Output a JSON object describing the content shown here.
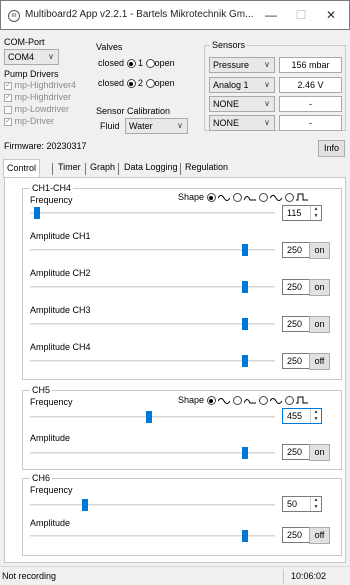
{
  "window": {
    "title": "Multiboard2 App v2.2.1 - Bartels Mikrotechnik Gm...",
    "icon_text": "m",
    "minimize": "—",
    "maximize": "☐",
    "close": "✕"
  },
  "com_port": {
    "label": "COM-Port",
    "value": "COM4"
  },
  "pump_drivers": {
    "label": "Pump Drivers",
    "items": [
      {
        "label": "mp-Highdriver4",
        "checked": true
      },
      {
        "label": "mp-Highdriver",
        "checked": true
      },
      {
        "label": "mp-Lowdriver",
        "checked": false
      },
      {
        "label": "mp-Driver",
        "checked": true
      }
    ]
  },
  "valves": {
    "label": "Valves",
    "rows": [
      {
        "state": "closed",
        "number": "1",
        "open": "open"
      },
      {
        "state": "closed",
        "number": "2",
        "open": "open"
      }
    ]
  },
  "sensor_calibration": {
    "label": "Sensor Calibration",
    "fluid_label": "Fluid",
    "fluid_value": "Water"
  },
  "sensors": {
    "label": "Sensors",
    "rows": [
      {
        "type": "Pressure",
        "value": "156 mbar"
      },
      {
        "type": "Analog 1",
        "value": "2.46 V"
      },
      {
        "type": "NONE",
        "value": "-"
      },
      {
        "type": "NONE",
        "value": "-"
      }
    ]
  },
  "firmware": "Firmware: 20230317",
  "info_button": "Info",
  "tabs": [
    "Control",
    "Timer",
    "Graph",
    "Data Logging",
    "Regulation"
  ],
  "control": {
    "ch1_4": {
      "title": "CH1-CH4",
      "frequency_label": "Frequency",
      "shape_label": "Shape",
      "frequency": "115",
      "amplitudes": [
        {
          "label": "Amplitude CH1",
          "value": "250",
          "toggle": "on"
        },
        {
          "label": "Amplitude CH2",
          "value": "250",
          "toggle": "on"
        },
        {
          "label": "Amplitude CH3",
          "value": "250",
          "toggle": "on"
        },
        {
          "label": "Amplitude CH4",
          "value": "250",
          "toggle": "off"
        }
      ]
    },
    "ch5": {
      "title": "CH5",
      "frequency_label": "Frequency",
      "shape_label": "Shape",
      "frequency": "455",
      "amplitude_label": "Amplitude",
      "amplitude": "250",
      "toggle": "on"
    },
    "ch6": {
      "title": "CH6",
      "frequency_label": "Frequency",
      "frequency": "50",
      "amplitude_label": "Amplitude",
      "amplitude": "250",
      "toggle": "off"
    }
  },
  "status": {
    "left": "Not recording",
    "time": "10:06:02"
  },
  "colors": {
    "accent": "#0078d7",
    "panel": "#ffffff",
    "window": "#f0f0f0"
  }
}
